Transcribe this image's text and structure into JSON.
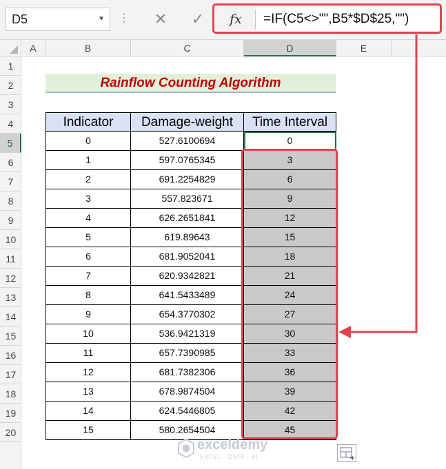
{
  "formula_bar": {
    "name_box": "D5",
    "fx_label": "fx",
    "cancel_glyph": "✕",
    "enter_glyph": "✓",
    "formula": "=IF(C5<>\"\",B5*$D$25,\"\")"
  },
  "columns": [
    "A",
    "B",
    "C",
    "D",
    "E"
  ],
  "selected_column": "D",
  "rows": [
    "1",
    "2",
    "3",
    "4",
    "5",
    "6",
    "7",
    "8",
    "9",
    "10",
    "11",
    "12",
    "13",
    "14",
    "15",
    "16",
    "17",
    "18",
    "19",
    "20"
  ],
  "selected_row": "5",
  "sheet_title": "Rainflow Counting Algorithm",
  "table": {
    "headers": [
      "Indicator",
      "Damage-weight",
      "Time Interval"
    ],
    "rows": [
      [
        "0",
        "527.6100694",
        "0"
      ],
      [
        "1",
        "597.0765345",
        "3"
      ],
      [
        "2",
        "691.2254829",
        "6"
      ],
      [
        "3",
        "557.823671",
        "9"
      ],
      [
        "4",
        "626.2651841",
        "12"
      ],
      [
        "5",
        "619.89643",
        "15"
      ],
      [
        "6",
        "681.9052041",
        "18"
      ],
      [
        "7",
        "620.9342821",
        "21"
      ],
      [
        "8",
        "641.5433489",
        "24"
      ],
      [
        "9",
        "654.3770302",
        "27"
      ],
      [
        "10",
        "536.9421319",
        "30"
      ],
      [
        "11",
        "657.7390985",
        "33"
      ],
      [
        "12",
        "681.7382306",
        "36"
      ],
      [
        "13",
        "678.9874504",
        "39"
      ],
      [
        "14",
        "624.5446805",
        "42"
      ],
      [
        "15",
        "580.2654504",
        "45"
      ]
    ]
  },
  "watermark": {
    "brand": "exceldemy",
    "tagline": "EXCEL · DATA · BI"
  },
  "colors": {
    "highlight": "#e0454f",
    "title_text": "#c00000",
    "title_fill": "#e2efda",
    "header_fill": "#d9e1f2",
    "filled_cells": "#c9c9c9",
    "selection": "#217346"
  },
  "icons": [
    "fx-icon",
    "cancel-icon",
    "enter-icon",
    "quick-analysis-icon",
    "exceldemy-logo-icon"
  ]
}
